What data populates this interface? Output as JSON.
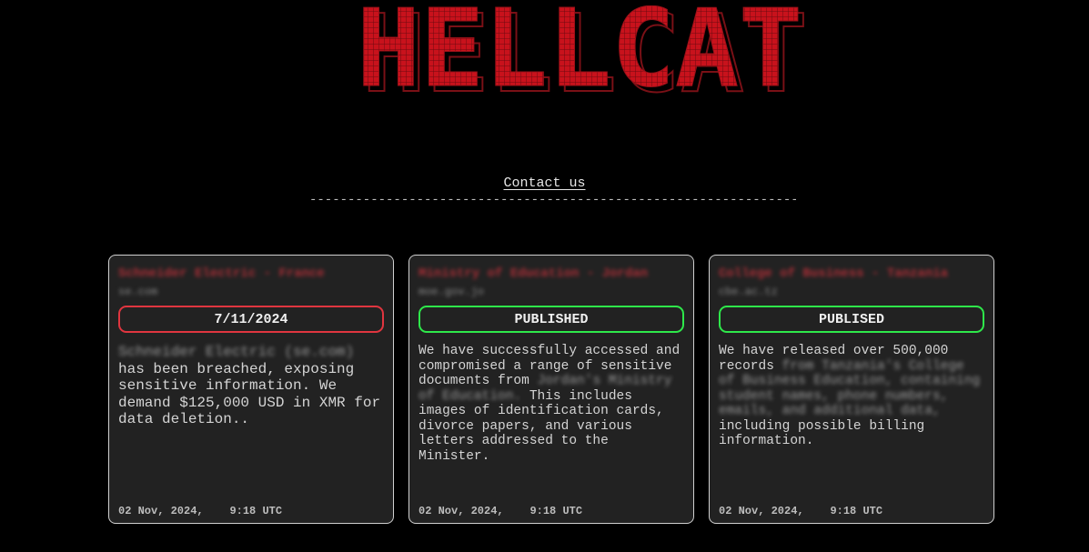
{
  "site": {
    "logo_text": "HELLCAT",
    "contact_label": "Contact us",
    "divider": "---------------------------------------------------------------------"
  },
  "colors": {
    "background": "#000000",
    "logo_red": "#c8121c",
    "card_bg": "#222222",
    "countdown_border": "#e0353f",
    "published_border": "#2ee84a"
  },
  "cards": [
    {
      "title": "Schneider Electric - France",
      "domain": "se.com",
      "status": "7/11/2024",
      "desc_redacted": "Schneider Electric (se.com)",
      "description": "has been breached, exposing sensitive information. We demand $125,000 USD in XMR for data deletion..",
      "date": "02 Nov, 2024,",
      "time": "9:18 UTC"
    },
    {
      "title": "Ministry of Education - Jordan",
      "domain": "moe.gov.jo",
      "status": "PUBLISHED",
      "desc_before": "We have successfully accessed and compromised a range of sensitive documents from ",
      "desc_redacted": "Jordan's Ministry of Education.",
      "desc_after": " This includes images of identification cards, divorce papers, and various letters addressed to the Minister.",
      "date": "02 Nov, 2024,",
      "time": "9:18 UTC"
    },
    {
      "title": "College of Business - Tanzania",
      "domain": "cbe.ac.tz",
      "status": "PUBLISED",
      "desc_before": "We have released over 500,000 records ",
      "desc_redacted": "from Tanzania's College of Business Education, containing student names, phone numbers, emails, and additional data,",
      "desc_after": " including possible billing information.",
      "date": "02 Nov, 2024,",
      "time": "9:18 UTC"
    }
  ]
}
